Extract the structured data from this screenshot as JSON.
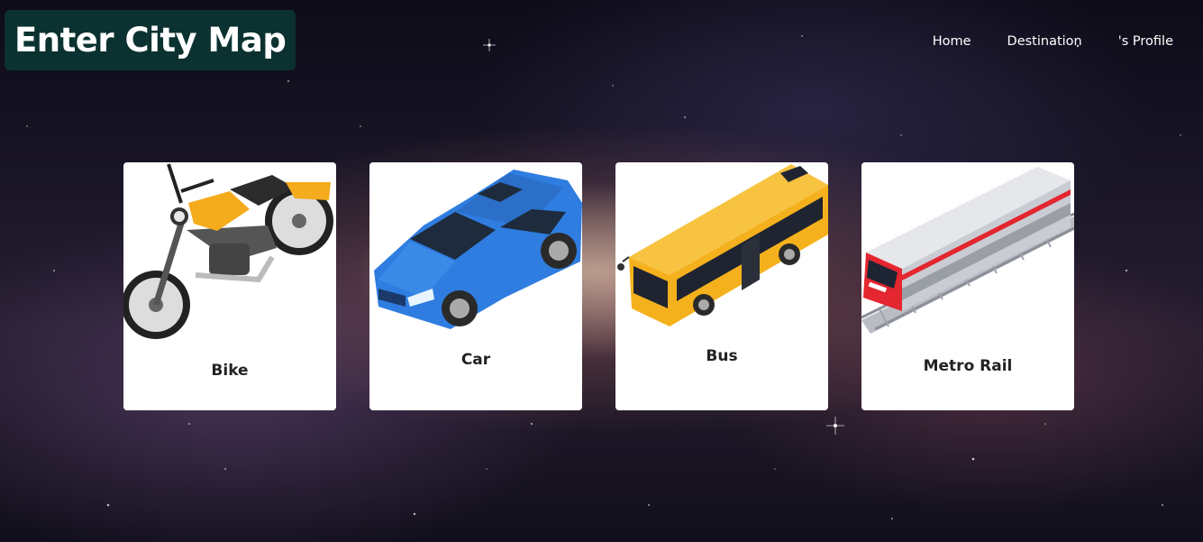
{
  "header": {
    "title": "Enter City Map"
  },
  "nav": {
    "items": [
      "Home",
      "Destination",
      "'s Profile"
    ]
  },
  "cards": [
    {
      "label": "Bike",
      "icon": "motorbike-icon"
    },
    {
      "label": "Car",
      "icon": "car-icon"
    },
    {
      "label": "Bus",
      "icon": "bus-icon"
    },
    {
      "label": "Metro Rail",
      "icon": "train-icon"
    }
  ],
  "colors": {
    "brand_bg": "#0b3230",
    "card_bg": "#ffffff",
    "car_blue": "#2f7de1",
    "bus_yellow": "#f5b11d",
    "bike_yellow": "#f4ac1c",
    "train_red": "#e3262f"
  }
}
